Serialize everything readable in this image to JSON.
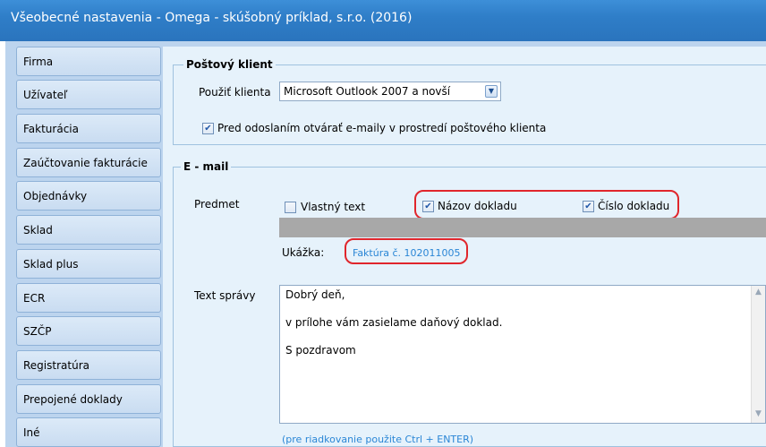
{
  "window": {
    "title": "Všeobecné nastavenia - Omega - skúšobný príklad, s.r.o. (2016)"
  },
  "sidebar": {
    "items": [
      "Firma",
      "Užívateľ",
      "Fakturácia",
      "Zaúčtovanie fakturácie",
      "Objednávky",
      "Sklad",
      "Sklad plus",
      "ECR",
      "SZČP",
      "Registratúra",
      "Prepojené doklady",
      "Iné"
    ]
  },
  "mail_client": {
    "title": "Poštový klient",
    "use_client_label": "Použiť klienta",
    "client_value": "Microsoft Outlook 2007 a novší",
    "open_in_client_label": "Pred odoslaním otvárať e-maily v prostredí poštového klienta",
    "open_in_client_checked": "✔"
  },
  "email": {
    "title": "E - mail",
    "subject_label": "Predmet",
    "own_text_label": "Vlastný text",
    "doc_name_label": "Názov dokladu",
    "doc_name_checked": "✔",
    "doc_number_label": "Číslo dokladu",
    "doc_number_checked": "✔",
    "preview_label": "Ukážka:",
    "preview_value": "Faktúra č. 102011005",
    "message_label": "Text správy",
    "message_lines": [
      "Dobrý deň,",
      "v prílohe vám zasielame daňový doklad.",
      "S pozdravom"
    ],
    "hint": "(pre riadkovanie použite Ctrl + ENTER)"
  }
}
